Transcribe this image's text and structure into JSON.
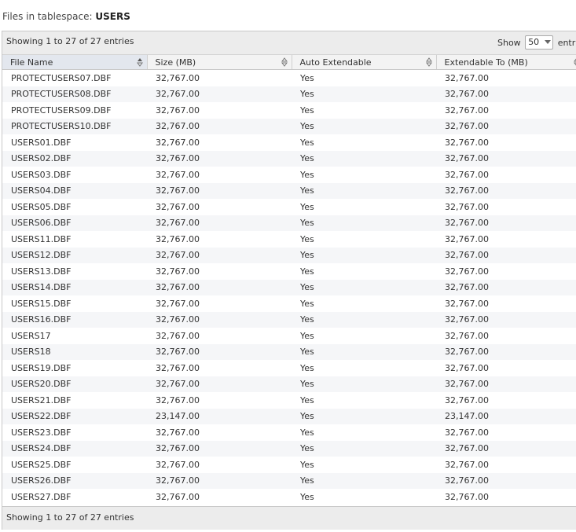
{
  "title": {
    "prefix": "Files in tablespace:",
    "tablespace": "USERS"
  },
  "toolbar": {
    "info": "Showing 1 to 27 of 27 entries",
    "show_label": "Show",
    "page_size": "50",
    "entries_label": "entries"
  },
  "columns": [
    {
      "label": "File Name"
    },
    {
      "label": "Size (MB)"
    },
    {
      "label": "Auto Extendable"
    },
    {
      "label": "Extendable To (MB)"
    }
  ],
  "rows": [
    {
      "file": "PROTECTUSERS07.DBF",
      "size": "32,767.00",
      "auto": "Yes",
      "max": "32,767.00"
    },
    {
      "file": "PROTECTUSERS08.DBF",
      "size": "32,767.00",
      "auto": "Yes",
      "max": "32,767.00"
    },
    {
      "file": "PROTECTUSERS09.DBF",
      "size": "32,767.00",
      "auto": "Yes",
      "max": "32,767.00"
    },
    {
      "file": "PROTECTUSERS10.DBF",
      "size": "32,767.00",
      "auto": "Yes",
      "max": "32,767.00"
    },
    {
      "file": "USERS01.DBF",
      "size": "32,767.00",
      "auto": "Yes",
      "max": "32,767.00"
    },
    {
      "file": "USERS02.DBF",
      "size": "32,767.00",
      "auto": "Yes",
      "max": "32,767.00"
    },
    {
      "file": "USERS03.DBF",
      "size": "32,767.00",
      "auto": "Yes",
      "max": "32,767.00"
    },
    {
      "file": "USERS04.DBF",
      "size": "32,767.00",
      "auto": "Yes",
      "max": "32,767.00"
    },
    {
      "file": "USERS05.DBF",
      "size": "32,767.00",
      "auto": "Yes",
      "max": "32,767.00"
    },
    {
      "file": "USERS06.DBF",
      "size": "32,767.00",
      "auto": "Yes",
      "max": "32,767.00"
    },
    {
      "file": "USERS11.DBF",
      "size": "32,767.00",
      "auto": "Yes",
      "max": "32,767.00"
    },
    {
      "file": "USERS12.DBF",
      "size": "32,767.00",
      "auto": "Yes",
      "max": "32,767.00"
    },
    {
      "file": "USERS13.DBF",
      "size": "32,767.00",
      "auto": "Yes",
      "max": "32,767.00"
    },
    {
      "file": "USERS14.DBF",
      "size": "32,767.00",
      "auto": "Yes",
      "max": "32,767.00"
    },
    {
      "file": "USERS15.DBF",
      "size": "32,767.00",
      "auto": "Yes",
      "max": "32,767.00"
    },
    {
      "file": "USERS16.DBF",
      "size": "32,767.00",
      "auto": "Yes",
      "max": "32,767.00"
    },
    {
      "file": "USERS17",
      "size": "32,767.00",
      "auto": "Yes",
      "max": "32,767.00"
    },
    {
      "file": "USERS18",
      "size": "32,767.00",
      "auto": "Yes",
      "max": "32,767.00"
    },
    {
      "file": "USERS19.DBF",
      "size": "32,767.00",
      "auto": "Yes",
      "max": "32,767.00"
    },
    {
      "file": "USERS20.DBF",
      "size": "32,767.00",
      "auto": "Yes",
      "max": "32,767.00"
    },
    {
      "file": "USERS21.DBF",
      "size": "32,767.00",
      "auto": "Yes",
      "max": "32,767.00"
    },
    {
      "file": "USERS22.DBF",
      "size": "23,147.00",
      "auto": "Yes",
      "max": "23,147.00"
    },
    {
      "file": "USERS23.DBF",
      "size": "32,767.00",
      "auto": "Yes",
      "max": "32,767.00"
    },
    {
      "file": "USERS24.DBF",
      "size": "32,767.00",
      "auto": "Yes",
      "max": "32,767.00"
    },
    {
      "file": "USERS25.DBF",
      "size": "32,767.00",
      "auto": "Yes",
      "max": "32,767.00"
    },
    {
      "file": "USERS26.DBF",
      "size": "32,767.00",
      "auto": "Yes",
      "max": "32,767.00"
    },
    {
      "file": "USERS27.DBF",
      "size": "32,767.00",
      "auto": "Yes",
      "max": "32,767.00"
    }
  ],
  "footer": {
    "info": "Showing 1 to 27 of 27 entries"
  },
  "colors": {
    "header_active": "#e3e7ee",
    "row_alt": "#f5f6f8",
    "toolbar": "#ececec"
  }
}
